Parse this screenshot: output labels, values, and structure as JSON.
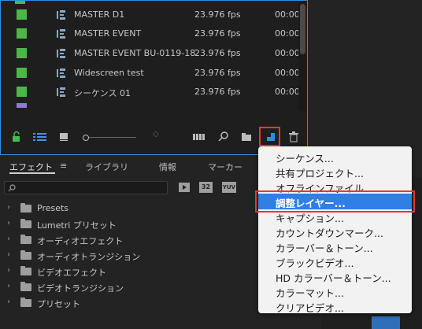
{
  "project": {
    "rows": [
      {
        "name": "MASTER D1",
        "fps": "23.976 fps",
        "dur": "00:00:",
        "color": "#4cb748"
      },
      {
        "name": "MASTER EVENT",
        "fps": "23.976 fps",
        "dur": "00:00:",
        "color": "#4cb748"
      },
      {
        "name": "MASTER EVENT BU-0119-18",
        "fps": "23.976 fps",
        "dur": "00:00:",
        "color": "#4cb748"
      },
      {
        "name": "Widescreen test",
        "fps": "23.976 fps",
        "dur": "00:00:",
        "color": "#4cb748"
      },
      {
        "name": "シーケンス 01",
        "fps": "23.976 fps",
        "dur": "00:00:",
        "color": "#4cb748"
      }
    ]
  },
  "tabs": {
    "effects": "エフェクト",
    "library": "ライブラリ",
    "info": "情報",
    "markers": "マーカー"
  },
  "effects_tree": [
    {
      "label": "Presets"
    },
    {
      "label": "Lumetri プリセット"
    },
    {
      "label": "オーディオエフェクト"
    },
    {
      "label": "オーディオトランジション"
    },
    {
      "label": "ビデオエフェクト"
    },
    {
      "label": "ビデオトランジション"
    },
    {
      "label": "プリセット"
    }
  ],
  "badges": {
    "b1": "32",
    "b2": "YUV"
  },
  "context_menu": {
    "items": [
      "シーケンス...",
      "共有プロジェクト...",
      "オフラインファイル...",
      "調整レイヤー...",
      "キャプション...",
      "カウントダウンマーク...",
      "カラーバー＆トーン...",
      "ブラックビデオ...",
      "HD カラーバー＆トーン...",
      "カラーマット...",
      "クリアビデオ..."
    ],
    "highlighted_index": 3
  },
  "colors": {
    "accent": "#2f7fe6",
    "highlight_box": "#e8392a",
    "label_green": "#4cb748"
  }
}
